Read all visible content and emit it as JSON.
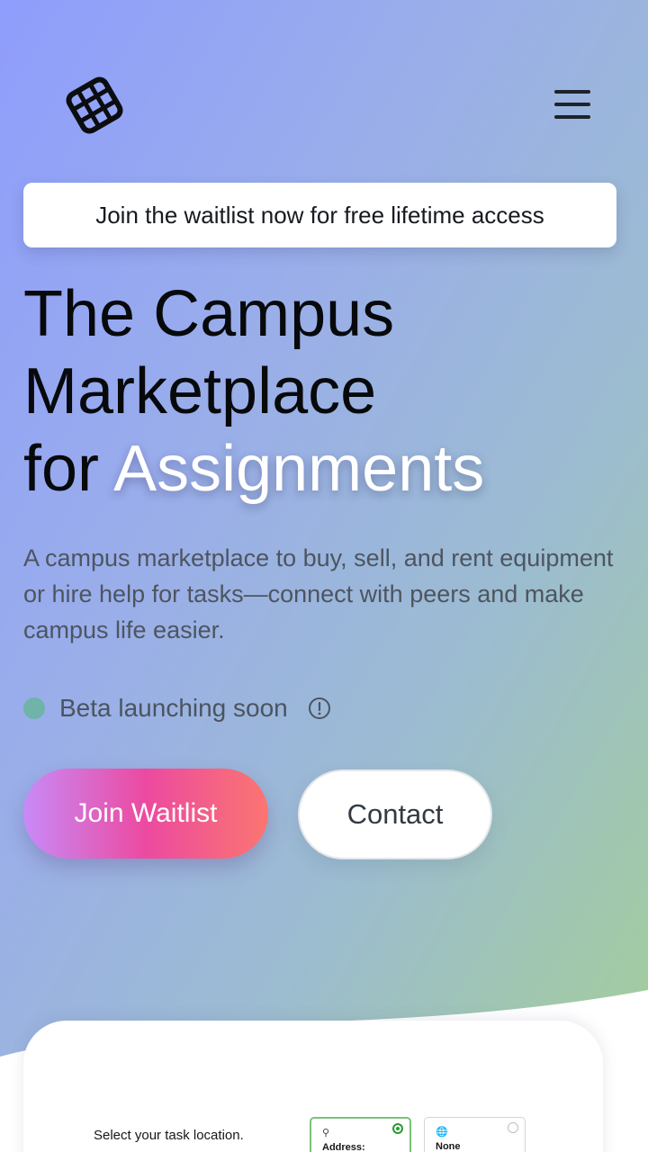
{
  "header": {
    "logo_icon": "grid-logo-icon",
    "menu_icon": "hamburger-menu-icon"
  },
  "banner": {
    "text": "Join the waitlist now for free lifetime access"
  },
  "hero": {
    "headline_line1": "The Campus",
    "headline_line2": "Marketplace",
    "headline_for": "for",
    "headline_accent": "Assignments",
    "subtitle": "A campus marketplace to buy, sell, and rent equipment or hire help for tasks—connect with peers and make campus life easier.",
    "status_text": "Beta launching soon",
    "status_icon": "info-icon",
    "status_color": "#6fb3a9"
  },
  "actions": {
    "join_label": "Join Waitlist",
    "contact_label": "Contact"
  },
  "preview": {
    "location_prompt": "Select your task location.",
    "options": [
      {
        "label": "Address:",
        "icon": "pin-icon",
        "selected": true
      },
      {
        "label": "None",
        "icon": "globe-icon",
        "selected": false
      }
    ]
  },
  "colors": {
    "accent_gradient_start": "#c88af8",
    "accent_gradient_mid": "#ec4aa0",
    "accent_gradient_end": "#fb7570",
    "selected_green": "#2f9b36"
  }
}
